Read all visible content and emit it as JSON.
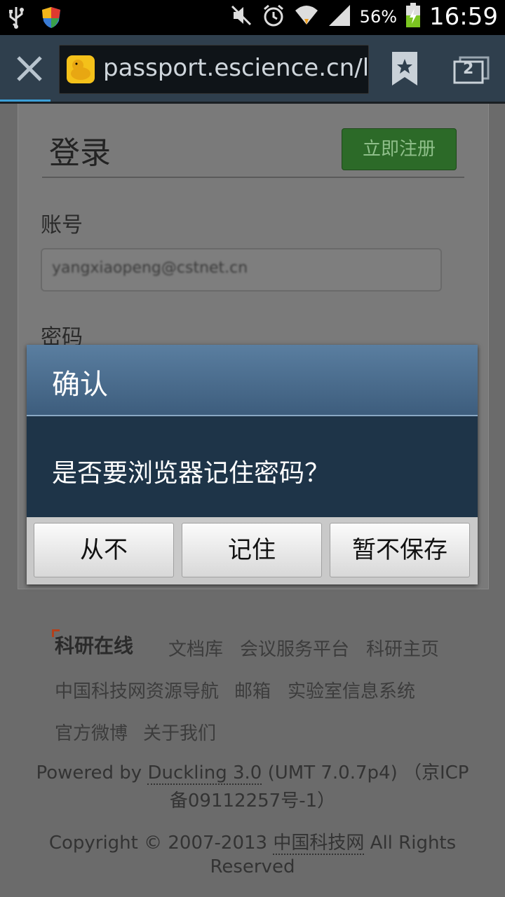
{
  "status_bar": {
    "battery_percent": "56%",
    "time": "16:59",
    "icons": [
      "usb-icon",
      "shield-icon",
      "mute-icon",
      "alarm-icon",
      "wifi-icon",
      "signal-icon",
      "battery-charging-icon"
    ]
  },
  "toolbar": {
    "url": "passport.escience.cn/l",
    "tab_count": "2"
  },
  "page": {
    "login_title": "登录",
    "register_button": "立即注册",
    "account_label": "账号",
    "account_value": "yangxiaopeng@cstnet.cn",
    "password_label": "密码"
  },
  "dialog": {
    "title": "确认",
    "message": "是否要浏览器记住密码？",
    "buttons": [
      "从不",
      "记住",
      "暂不保存"
    ]
  },
  "footer": {
    "logo_text": "科研在线",
    "links_row1": [
      "文档库",
      "会议服务平台",
      "科研主页"
    ],
    "links_row2": [
      "中国科技网资源导航",
      "邮箱",
      "实验室信息系统"
    ],
    "links_row3": [
      "官方微博",
      "关于我们"
    ],
    "powered_prefix": "Powered by ",
    "powered_link": "Duckling 3.0",
    "powered_suffix": " (UMT 7.0.7p4) （京ICP",
    "icp_line": "备09112257号-1）",
    "copyright_prefix": "Copyright © 2007-2013 ",
    "copyright_link": "中国科技网",
    "copyright_suffix": " All Rights",
    "reserved": "Reserved"
  },
  "colors": {
    "register_green": "#2c6a28",
    "dialog_header": "#4a6c8e",
    "dialog_body": "#1e3448",
    "progress_blue": "#3ca0d8"
  }
}
